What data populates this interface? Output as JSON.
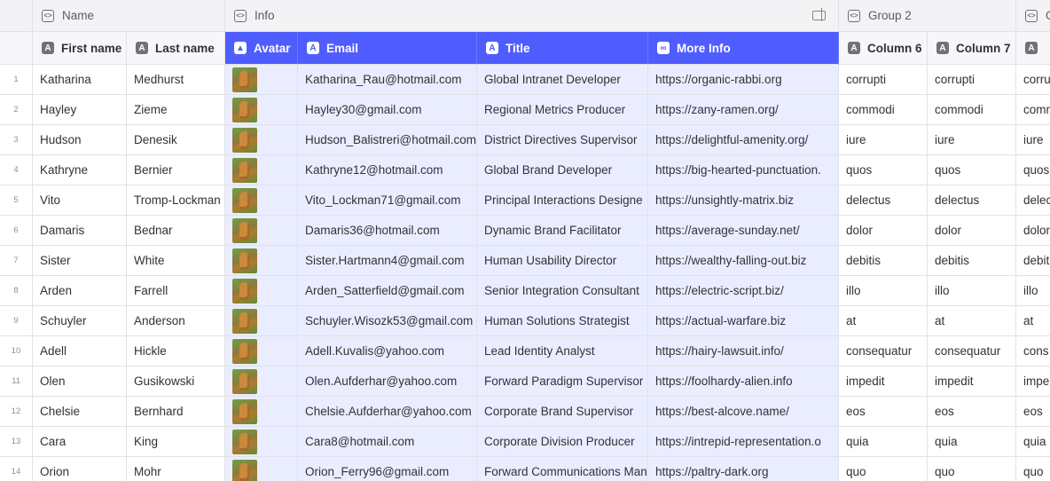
{
  "groups": [
    {
      "label": ""
    },
    {
      "label": "Name"
    },
    {
      "label": "Info"
    },
    {
      "label": "Group 2"
    },
    {
      "label": "G"
    }
  ],
  "columns": [
    {
      "label": "First name",
      "icon": "text-column-icon"
    },
    {
      "label": "Last name",
      "icon": "text-column-icon"
    },
    {
      "label": "Avatar",
      "icon": "image-column-icon"
    },
    {
      "label": "Email",
      "icon": "text-column-icon"
    },
    {
      "label": "Title",
      "icon": "text-column-icon"
    },
    {
      "label": "More Info",
      "icon": "link-column-icon"
    },
    {
      "label": "Column 6",
      "icon": "text-column-icon"
    },
    {
      "label": "Column 7",
      "icon": "text-column-icon"
    },
    {
      "label": "",
      "icon": "text-column-icon"
    }
  ],
  "colors": {
    "accent": "#4f5dff",
    "highlight": "#eaedff"
  },
  "rows": [
    {
      "n": "1",
      "first": "Katharina",
      "last": "Medhurst",
      "email": "Katharina_Rau@hotmail.com",
      "title": "Global Intranet Developer",
      "info": "https://organic-rabbi.org",
      "c6": "corrupti",
      "c7": "corrupti",
      "c8": "corru"
    },
    {
      "n": "2",
      "first": "Hayley",
      "last": "Zieme",
      "email": "Hayley30@gmail.com",
      "title": "Regional Metrics Producer",
      "info": "https://zany-ramen.org/",
      "c6": "commodi",
      "c7": "commodi",
      "c8": "comm"
    },
    {
      "n": "3",
      "first": "Hudson",
      "last": "Denesik",
      "email": "Hudson_Balistreri@hotmail.com",
      "title": "District Directives Supervisor",
      "info": "https://delightful-amenity.org/",
      "c6": "iure",
      "c7": "iure",
      "c8": "iure"
    },
    {
      "n": "4",
      "first": "Kathryne",
      "last": "Bernier",
      "email": "Kathryne12@hotmail.com",
      "title": "Global Brand Developer",
      "info": "https://big-hearted-punctuation.",
      "c6": "quos",
      "c7": "quos",
      "c8": "quos"
    },
    {
      "n": "5",
      "first": "Vito",
      "last": "Tromp-Lockman",
      "email": "Vito_Lockman71@gmail.com",
      "title": "Principal Interactions Designe",
      "info": "https://unsightly-matrix.biz",
      "c6": "delectus",
      "c7": "delectus",
      "c8": "delec"
    },
    {
      "n": "6",
      "first": "Damaris",
      "last": "Bednar",
      "email": "Damaris36@hotmail.com",
      "title": "Dynamic Brand Facilitator",
      "info": "https://average-sunday.net/",
      "c6": "dolor",
      "c7": "dolor",
      "c8": "dolor"
    },
    {
      "n": "7",
      "first": "Sister",
      "last": "White",
      "email": "Sister.Hartmann4@gmail.com",
      "title": "Human Usability Director",
      "info": "https://wealthy-falling-out.biz",
      "c6": "debitis",
      "c7": "debitis",
      "c8": "debit"
    },
    {
      "n": "8",
      "first": "Arden",
      "last": "Farrell",
      "email": "Arden_Satterfield@gmail.com",
      "title": "Senior Integration Consultant",
      "info": "https://electric-script.biz/",
      "c6": "illo",
      "c7": "illo",
      "c8": "illo"
    },
    {
      "n": "9",
      "first": "Schuyler",
      "last": "Anderson",
      "email": "Schuyler.Wisozk53@gmail.com",
      "title": "Human Solutions Strategist",
      "info": "https://actual-warfare.biz",
      "c6": "at",
      "c7": "at",
      "c8": "at"
    },
    {
      "n": "10",
      "first": "Adell",
      "last": "Hickle",
      "email": "Adell.Kuvalis@yahoo.com",
      "title": "Lead Identity Analyst",
      "info": "https://hairy-lawsuit.info/",
      "c6": "consequatur",
      "c7": "consequatur",
      "c8": "cons"
    },
    {
      "n": "11",
      "first": "Olen",
      "last": "Gusikowski",
      "email": "Olen.Aufderhar@yahoo.com",
      "title": "Forward Paradigm Supervisor",
      "info": "https://foolhardy-alien.info",
      "c6": "impedit",
      "c7": "impedit",
      "c8": "impe"
    },
    {
      "n": "12",
      "first": "Chelsie",
      "last": "Bernhard",
      "email": "Chelsie.Aufderhar@yahoo.com",
      "title": "Corporate Brand Supervisor",
      "info": "https://best-alcove.name/",
      "c6": "eos",
      "c7": "eos",
      "c8": "eos"
    },
    {
      "n": "13",
      "first": "Cara",
      "last": "King",
      "email": "Cara8@hotmail.com",
      "title": "Corporate Division Producer",
      "info": "https://intrepid-representation.o",
      "c6": "quia",
      "c7": "quia",
      "c8": "quia"
    },
    {
      "n": "14",
      "first": "Orion",
      "last": "Mohr",
      "email": "Orion_Ferry96@gmail.com",
      "title": "Forward Communications Man",
      "info": "https://paltry-dark.org",
      "c6": "quo",
      "c7": "quo",
      "c8": "quo"
    }
  ]
}
